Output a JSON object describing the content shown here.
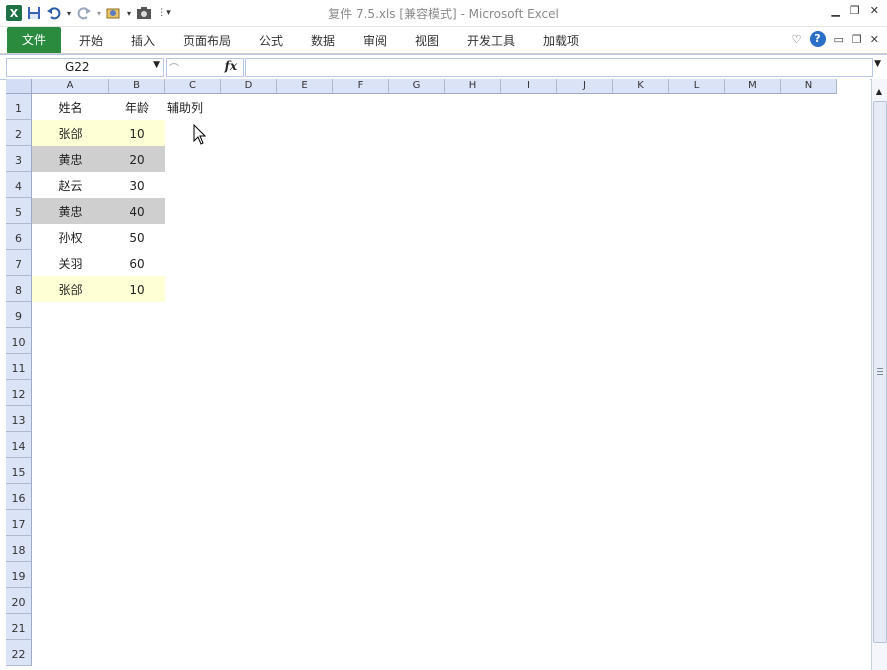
{
  "window": {
    "title": "复件 7.5.xls  [兼容模式]  -  Microsoft Excel"
  },
  "ribbon": {
    "file_tab": "文件",
    "tabs": [
      "开始",
      "插入",
      "页面布局",
      "公式",
      "数据",
      "审阅",
      "视图",
      "开发工具",
      "加载项"
    ]
  },
  "formula_bar": {
    "name_box": "G22",
    "fx_label": "fx",
    "formula": ""
  },
  "columns": [
    "A",
    "B",
    "C",
    "D",
    "E",
    "F",
    "G",
    "H",
    "I",
    "J",
    "K",
    "L",
    "M",
    "N"
  ],
  "rows": [
    "1",
    "2",
    "3",
    "4",
    "5",
    "6",
    "7",
    "8",
    "9",
    "10",
    "11",
    "12",
    "13",
    "14",
    "15",
    "16",
    "17",
    "18",
    "19",
    "20",
    "21",
    "22"
  ],
  "sheet": {
    "header": {
      "a": "姓名",
      "b": "年龄",
      "c": "辅助列"
    },
    "data": [
      {
        "name": "张郃",
        "age": "10",
        "fill": "#ffffd6"
      },
      {
        "name": "黄忠",
        "age": "20",
        "fill": "#cfcfcf"
      },
      {
        "name": "赵云",
        "age": "30",
        "fill": ""
      },
      {
        "name": "黄忠",
        "age": "40",
        "fill": "#cfcfcf"
      },
      {
        "name": "孙权",
        "age": "50",
        "fill": ""
      },
      {
        "name": "关羽",
        "age": "60",
        "fill": ""
      },
      {
        "name": "张郃",
        "age": "10",
        "fill": "#ffffd6"
      }
    ]
  },
  "colors": {
    "file_tab": "#2a8a3d",
    "header_bg": "#dbe3f7",
    "highlight_yellow": "#ffffd6",
    "highlight_gray": "#cfcfcf"
  }
}
